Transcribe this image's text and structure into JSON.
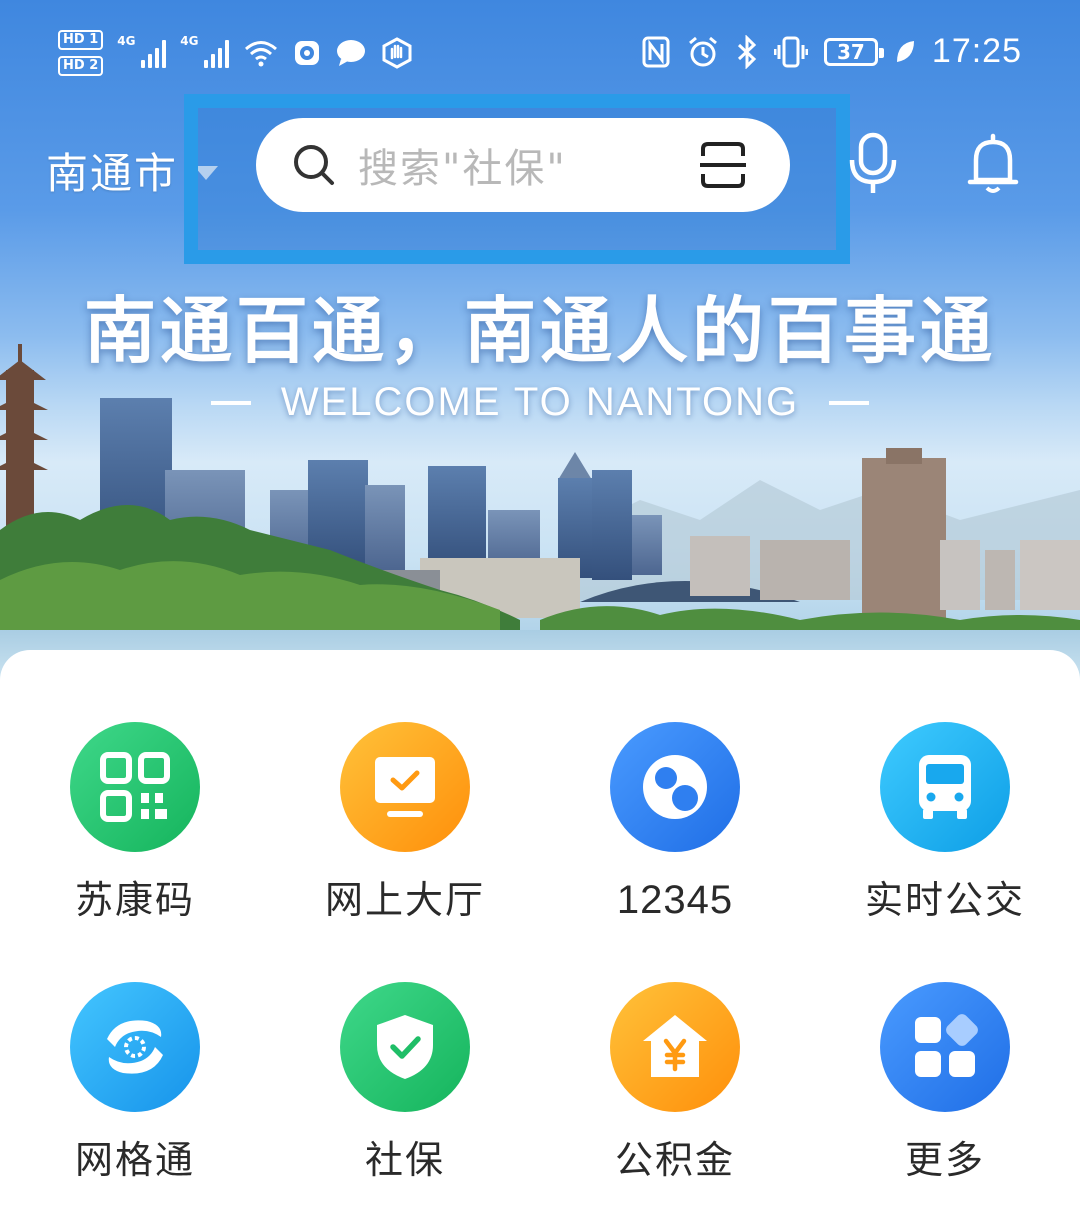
{
  "status_bar": {
    "sim1": "HD 1",
    "sim2": "HD 2",
    "net1": "4G",
    "net2": "4G",
    "battery": "37",
    "time": "17:25",
    "icons": [
      "wifi-icon",
      "camera-notify-icon",
      "chat-notify-icon",
      "hand-icon",
      "nfc-icon",
      "alarm-icon",
      "bluetooth-icon",
      "vibrate-icon",
      "leaf-icon"
    ]
  },
  "header": {
    "city": "南通市",
    "search_placeholder": "搜索\"社保\"",
    "highlight_color": "#2a9be8"
  },
  "banner": {
    "slogan": "南通百通，南通人的百事通",
    "welcome": "WELCOME TO NANTONG"
  },
  "services": [
    {
      "label": "苏康码",
      "icon": "qr-code-icon",
      "color": "#22c16d"
    },
    {
      "label": "网上大厅",
      "icon": "monitor-check-icon",
      "color": "#ffa21a"
    },
    {
      "label": "12345",
      "icon": "hotline-bubble-icon",
      "color": "#2f7ff0"
    },
    {
      "label": "实时公交",
      "icon": "bus-icon",
      "color": "#1eb0f0"
    },
    {
      "label": "网格通",
      "icon": "grid-swirl-icon",
      "color": "#22a6ee"
    },
    {
      "label": "社保",
      "icon": "shield-check-icon",
      "color": "#22c16d"
    },
    {
      "label": "公积金",
      "icon": "house-yen-icon",
      "color": "#ffa21a"
    },
    {
      "label": "更多",
      "icon": "apps-grid-icon",
      "color": "#2f7ff0"
    }
  ]
}
